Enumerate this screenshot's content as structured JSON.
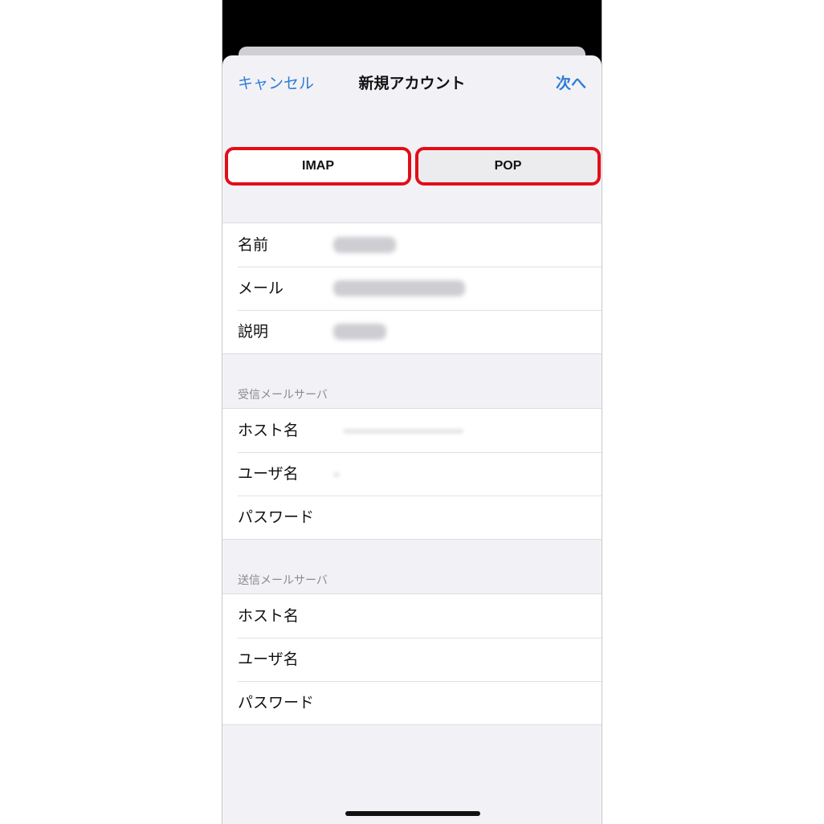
{
  "nav": {
    "cancel": "キャンセル",
    "title": "新規アカウント",
    "next": "次へ"
  },
  "segments": {
    "imap": "IMAP",
    "pop": "POP"
  },
  "account": {
    "name_label": "名前",
    "email_label": "メール",
    "description_label": "説明"
  },
  "incoming": {
    "header": "受信メールサーバ",
    "host_label": "ホスト名",
    "user_label": "ユーザ名",
    "password_label": "パスワード"
  },
  "outgoing": {
    "header": "送信メールサーバ",
    "host_label": "ホスト名",
    "user_label": "ユーザ名",
    "password_label": "パスワード"
  },
  "colors": {
    "accent": "#2e7bd8",
    "highlight": "#e30d18",
    "background": "#f2f2f6"
  }
}
